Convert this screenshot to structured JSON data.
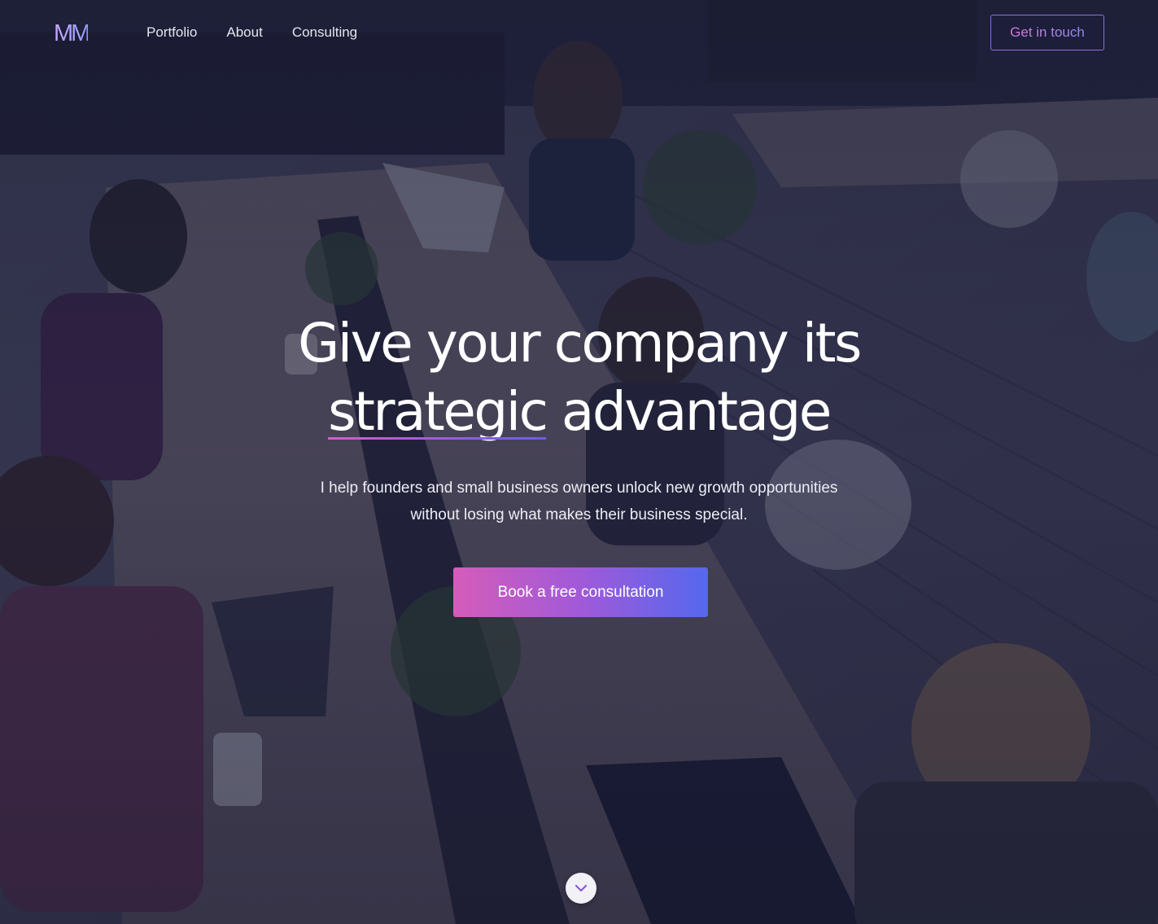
{
  "brand": {
    "logo_text": "MM"
  },
  "nav": {
    "links": [
      {
        "label": "Portfolio"
      },
      {
        "label": "About"
      },
      {
        "label": "Consulting"
      }
    ],
    "cta_label": "Get in touch"
  },
  "hero": {
    "headline_line1": "Give your company its",
    "headline_accent": "strategic",
    "headline_line2_rest": " advantage",
    "subtitle_line1": "I help founders and small business owners unlock new growth opportunities",
    "subtitle_line2": "without losing what makes their business special.",
    "cta_label": "Book a free consultation",
    "background": "office-team-photo"
  },
  "colors": {
    "accent_pink": "#d55cba",
    "accent_purple": "#a05ad8",
    "accent_blue": "#5468ee",
    "overlay": "#1a1c3a"
  },
  "icons": {
    "scroll": "chevron-down-icon"
  }
}
